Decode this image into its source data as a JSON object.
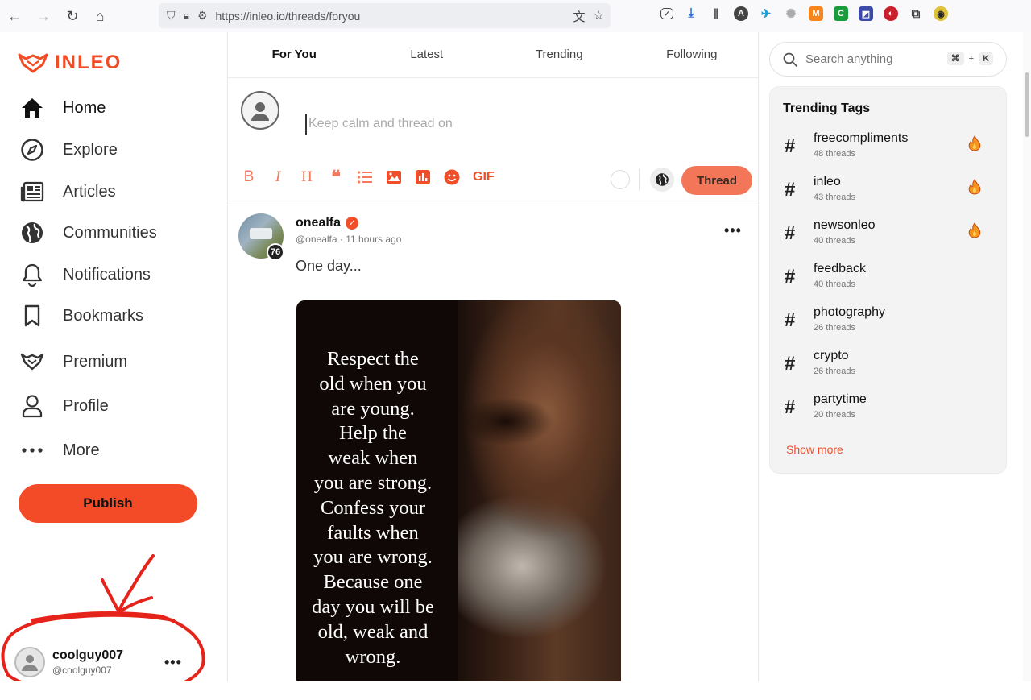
{
  "browser": {
    "url": "https://inleo.io/threads/foryou"
  },
  "brand": {
    "name": "INLEO",
    "accent": "#f24c26"
  },
  "nav": {
    "items": [
      {
        "label": "Home",
        "icon": "home-icon"
      },
      {
        "label": "Explore",
        "icon": "compass-icon"
      },
      {
        "label": "Articles",
        "icon": "newspaper-icon"
      },
      {
        "label": "Communities",
        "icon": "globe-icon"
      },
      {
        "label": "Notifications",
        "icon": "bell-icon"
      },
      {
        "label": "Bookmarks",
        "icon": "bookmark-icon"
      },
      {
        "label": "Premium",
        "icon": "premium-icon"
      },
      {
        "label": "Profile",
        "icon": "user-icon"
      },
      {
        "label": "More",
        "icon": "dots-icon"
      }
    ],
    "publish_label": "Publish"
  },
  "user": {
    "name": "coolguy007",
    "handle": "@coolguy007"
  },
  "feed": {
    "tabs": [
      "For You",
      "Latest",
      "Trending",
      "Following"
    ],
    "composer_placeholder": "Keep calm and thread on",
    "toolbar_gif": "GIF",
    "thread_label": "Thread"
  },
  "post": {
    "author": "onealfa",
    "handle": "@onealfa",
    "time": "11 hours ago",
    "reputation": "76",
    "text": "One day...",
    "image_quote": [
      "Respect the",
      "old when you",
      "are young.",
      "Help the",
      "weak when",
      "you are strong.",
      "Confess your",
      "faults when",
      "you are wrong.",
      "Because one",
      "day you will be",
      "old, weak and",
      "wrong."
    ]
  },
  "search": {
    "placeholder": "Search anything",
    "shortcut_mod": "⌘",
    "shortcut_plus": "+",
    "shortcut_key": "K"
  },
  "trending": {
    "title": "Trending Tags",
    "tags": [
      {
        "name": "freecompliments",
        "count": "48 threads",
        "hot": true
      },
      {
        "name": "inleo",
        "count": "43 threads",
        "hot": true
      },
      {
        "name": "newsonleo",
        "count": "40 threads",
        "hot": true
      },
      {
        "name": "feedback",
        "count": "40 threads",
        "hot": false
      },
      {
        "name": "photography",
        "count": "26 threads",
        "hot": false
      },
      {
        "name": "crypto",
        "count": "26 threads",
        "hot": false
      },
      {
        "name": "partytime",
        "count": "20 threads",
        "hot": false
      }
    ],
    "show_more": "Show more"
  },
  "annotation_color": "#e5231b"
}
